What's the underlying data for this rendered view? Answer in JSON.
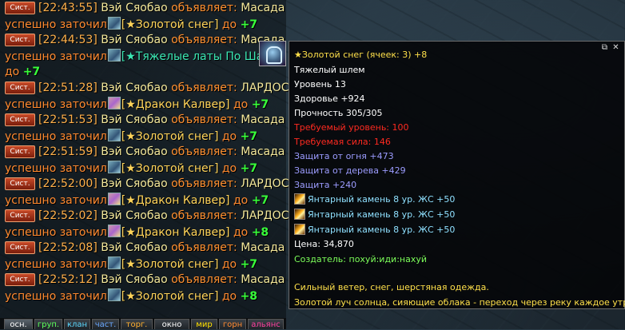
{
  "chat": {
    "badge": "Сист.",
    "speaker": "Вэй Сяобао",
    "verb": "объявляет:",
    "success": "успешно заточил",
    "to": "до",
    "entries": [
      {
        "time": "[22:43:55]",
        "target": "Масада",
        "item": "[★Золотой снег]",
        "level": "+7"
      },
      {
        "time": "[22:44:53]",
        "target": "Масада",
        "item": "[★Тяжелые латы По Шан",
        "level": "+7"
      },
      {
        "time": "[22:51:28]",
        "target": "ЛАРДОС",
        "item": "[★Дракон Калвер]",
        "level": "+7"
      },
      {
        "time": "[22:51:53]",
        "target": "Масада",
        "item": "[★Золотой снег]",
        "level": "+7"
      },
      {
        "time": "[22:51:59]",
        "target": "Масада",
        "item": "[★Золотой снег]",
        "level": "+7"
      },
      {
        "time": "[22:52:00]",
        "target": "ЛАРДОС",
        "item": "[★Дракон Калвер]",
        "level": "+7"
      },
      {
        "time": "[22:52:02]",
        "target": "ЛАРДОС",
        "item": "[★Дракон Калвер]",
        "level": "+8"
      },
      {
        "time": "[22:52:08]",
        "target": "Масада",
        "item": "[★Золотой снег]",
        "level": "+7"
      },
      {
        "time": "[22:52:12]",
        "target": "Масада",
        "item": "[★Золотой снег]",
        "level": "+8"
      }
    ]
  },
  "tabs": [
    {
      "label": "осн.",
      "color": "#ffffff",
      "active": true
    },
    {
      "label": "груп.",
      "color": "#5cff5c"
    },
    {
      "label": "клан",
      "color": "#5cd8ff"
    },
    {
      "label": "част.",
      "color": "#6aa8ff"
    },
    {
      "label": "торг.",
      "color": "#ffb030"
    },
    {
      "label": "окно",
      "color": "#ffffff"
    },
    {
      "label": "мир",
      "color": "#ffe000"
    },
    {
      "label": "горн",
      "color": "#ff8a30"
    },
    {
      "label": "альянс",
      "color": "#ff40a0"
    }
  ],
  "tooltip": {
    "title": "★Золотой снег (ячеек: 3) +8",
    "type": "Тяжелый шлем",
    "level": "Уровень 13",
    "hp": "Здоровье +924",
    "durability": "Прочность 305/305",
    "req_level": "Требуемый уровень: 100",
    "req_str": "Требуемая сила: 146",
    "fire_def": "Защита от огня +473",
    "wood_def": "Защита от дерева +429",
    "defense": "Защита +240",
    "gems": [
      "Янтарный камень 8 ур. ЖС +50",
      "Янтарный камень 8 ур. ЖС +50",
      "Янтарный камень 8 ур. ЖС +50"
    ],
    "price": "Цена: 34,870",
    "creator": "Создатель: похуй:иди:нахуй",
    "desc1": "Сильный ветер, снег, шерстяная одежда.",
    "desc2": "Золотой луч солнца, сияющие облака - переход через реку каждое утро.",
    "btn_copy": "⧉",
    "btn_close": "✕"
  }
}
